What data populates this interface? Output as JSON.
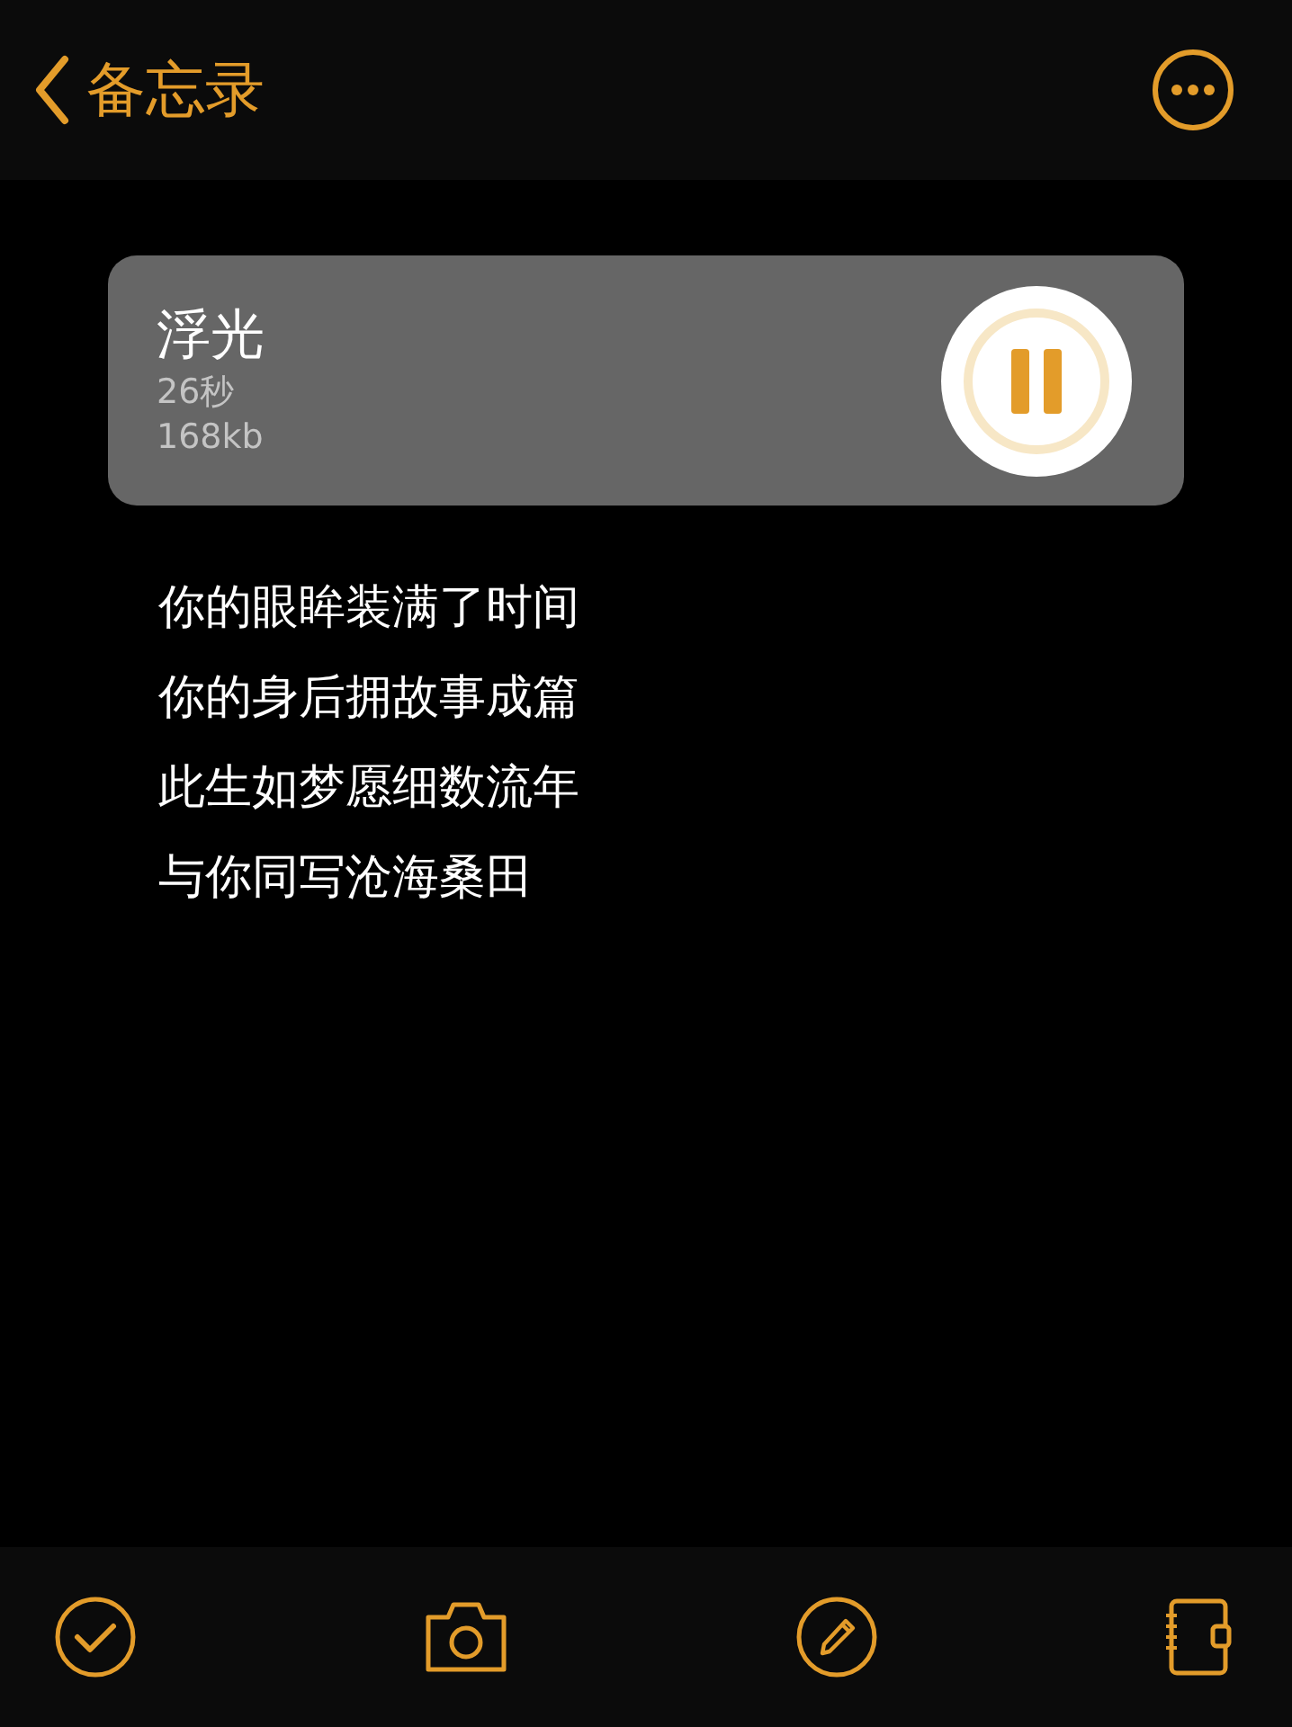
{
  "nav": {
    "back_label": "备忘录"
  },
  "recording": {
    "title": "浮光",
    "duration": "26秒",
    "size": "168kb",
    "playing": true
  },
  "lines": [
    "你的眼眸装满了时间",
    "你的身后拥故事成篇",
    "此生如梦愿细数流年",
    "与你同写沧海桑田"
  ]
}
